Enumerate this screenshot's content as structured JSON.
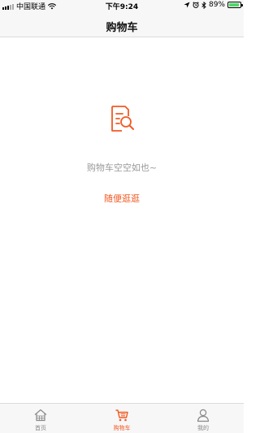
{
  "status_bar": {
    "carrier": "中国联通",
    "time": "下午9:24",
    "battery": "89%",
    "battery_level": 0.89,
    "icons": [
      "signal-icon",
      "wifi-icon",
      "location-icon",
      "alarm-icon",
      "bluetooth-icon",
      "battery-icon"
    ]
  },
  "nav": {
    "title": "购物车"
  },
  "empty_state": {
    "icon": "cart-empty-search-icon",
    "message": "购物车空空如也~",
    "browse_label": "随便逛逛"
  },
  "tab_bar": {
    "tabs": [
      {
        "label": "首页",
        "icon": "home-icon",
        "active": false
      },
      {
        "label": "购物车",
        "icon": "cart-icon",
        "active": true
      },
      {
        "label": "我的",
        "icon": "person-icon",
        "active": false
      }
    ]
  },
  "colors": {
    "accent": "#f15a24",
    "muted_text": "#999999",
    "bar_bg": "#f7f7f7"
  }
}
